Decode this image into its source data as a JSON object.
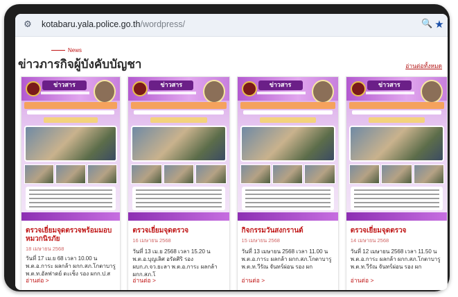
{
  "browser": {
    "url_host": "kotabaru.yala.police.go.th",
    "url_path": "/wordpress/"
  },
  "section": {
    "eyebrow": "News",
    "title": "ข่าวภารกิจผู้บังคับบัญชา",
    "read_all": "อ่านต่อทั้งหมด"
  },
  "posters": {
    "headline": "ข่าวสาร"
  },
  "cards": [
    {
      "title": "ตรวจเยี่ยมจุดตรวจพร้อมมอบหมวกนิรภัย",
      "date": "18 เมษายน 2568",
      "excerpt": "วันที่ 17 เม.ย 68 เวลา 10.00 น พ.ต.อ.การะ ผลกล้า ผกก.สภ.โกตาบารู พ.ต.ท.อัลฟาดย์ ดะเซ็ง รอง ผกก.ป.ส",
      "more": "อ่านต่อ >"
    },
    {
      "title": "ตรวจเยี่ยมจุดตรวจ",
      "date": "16 เมษายน 2568",
      "excerpt": "วันที่ 13 เม.ย 2568 เวลา 15.20 น พ.ต.อ.บุญเลิศ อรัดศิริ รอง ผบก.ภ.จว.ยะลา พ.ต.อ.การะ ผลกล้า ผกก.สภ.โ",
      "more": "อ่านต่อ >"
    },
    {
      "title": "กิจกรรมวันสงกรานต์",
      "date": "15 เมษายน 2568",
      "excerpt": "วันที่ 13 เมษายน 2568 เวลา 11.00 น พ.ต.อ.การะ ผลกล้า ผกก.สภ.โกตาบารู พ.ต.ท.วีรัณ จันทร์ผ่อน รอง ผก",
      "more": "อ่านต่อ >"
    },
    {
      "title": "ตรวจเยี่ยมจุดตรวจ",
      "date": "14 เมษายน 2568",
      "excerpt": "วันที่ 12 เมษายน 2568 เวลา 11.50 น พ.ต.อ.การะ ผลกล้า ผกก.สภ.โกตาบารู พ.ต.ท.วีรัณ จันทร์ผ่อน รอง ผก",
      "more": "อ่านต่อ >"
    }
  ]
}
